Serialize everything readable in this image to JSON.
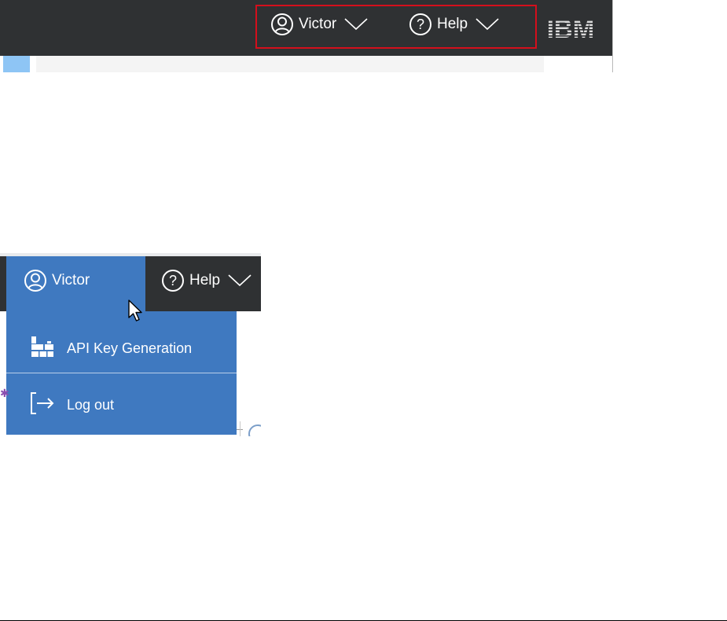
{
  "header": {
    "user_label": "Victor",
    "help_label": "Help",
    "logo_text": "IBM"
  },
  "user_menu": {
    "user_label": "Victor",
    "help_label": "Help",
    "items": [
      {
        "label": "API Key Generation",
        "icon": "api-key-icon"
      },
      {
        "label": "Log out",
        "icon": "logout-icon"
      }
    ]
  },
  "colors": {
    "header_bg": "#2f3133",
    "menu_blue": "#3f79c0",
    "highlight_red": "#d40f1c",
    "text_white": "#ffffff"
  }
}
